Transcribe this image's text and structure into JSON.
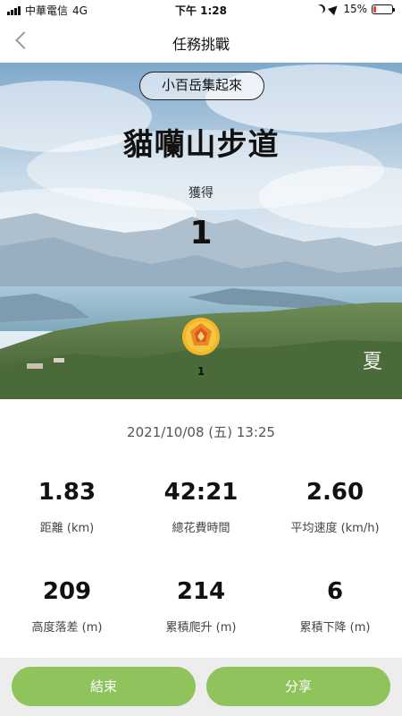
{
  "status_bar": {
    "carrier": "中華電信",
    "network": "4G",
    "time": "下午 1:28",
    "battery_text": "15%",
    "battery_level": 0.15
  },
  "nav": {
    "title": "任務挑戰"
  },
  "hero": {
    "tag": "小百岳集起來",
    "trail_name": "貓囒山步道",
    "earned_label": "獲得",
    "earned_count": "1",
    "medal_count": "1",
    "watermark": "夏"
  },
  "date": "2021/10/08 (五) 13:25",
  "stats": [
    {
      "value": "1.83",
      "label": "距離 (km)"
    },
    {
      "value": "42:21",
      "label": "總花費時間"
    },
    {
      "value": "2.60",
      "label": "平均速度 (km/h)"
    },
    {
      "value": "209",
      "label": "高度落差 (m)"
    },
    {
      "value": "214",
      "label": "累積爬升 (m)"
    },
    {
      "value": "6",
      "label": "累積下降 (m)"
    }
  ],
  "footer": {
    "end_label": "結束",
    "share_label": "分享"
  },
  "colors": {
    "accent_green": "#8fc35b",
    "battery_low": "#e8452c"
  }
}
